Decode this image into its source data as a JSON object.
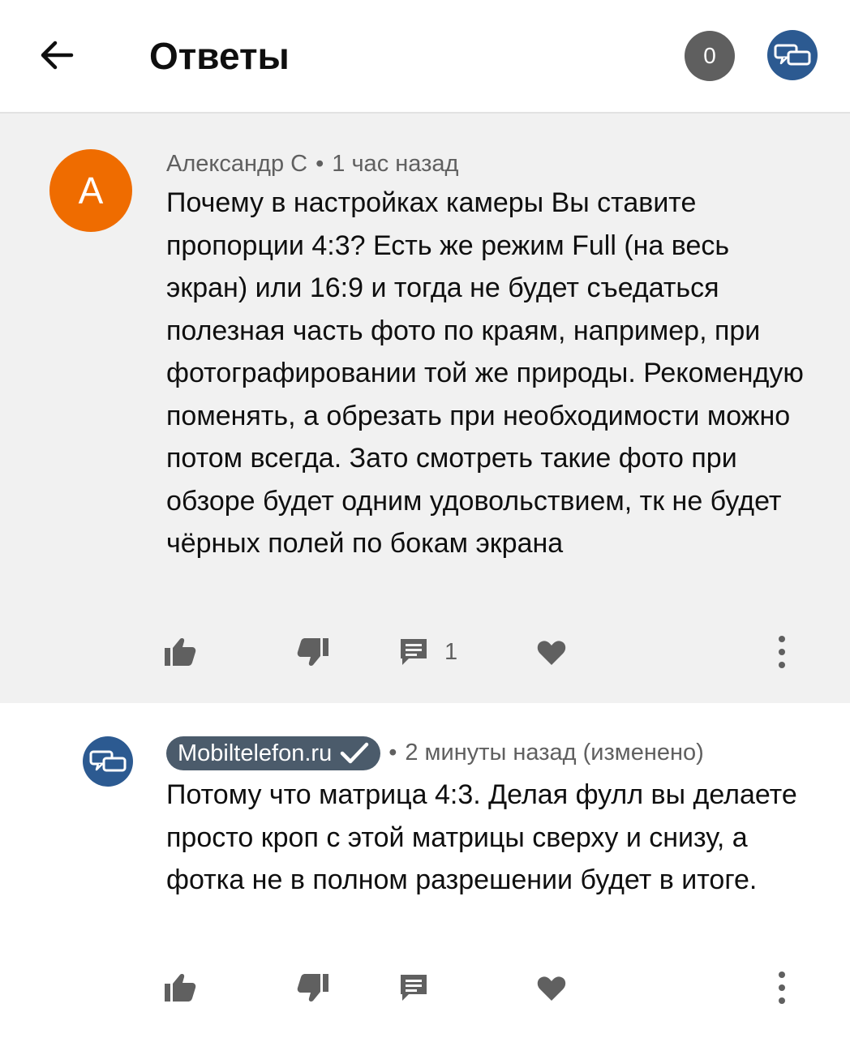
{
  "header": {
    "title": "Ответы",
    "count_badge": "0",
    "back_icon": "arrow-left-icon",
    "avatar_icon": "chat-bubbles-icon"
  },
  "comment": {
    "avatar_letter": "A",
    "avatar_color": "#ef6c00",
    "author": "Александр С",
    "separator": "•",
    "time": "1 час назад",
    "text": "Почему в настройках камеры Вы ставите пропорции 4:3? Есть же режим Full (на весь экран) или 16:9 и тогда не будет съедаться полезная часть фото по краям, например, при фотографировании той же природы. Рекомендую поменять, а обрезать при необходимости можно потом всегда. Зато смотреть такие фото при обзоре будет одним удовольствием, тк не будет чёрных полей по бокам экрана",
    "reply_count": "1"
  },
  "reply": {
    "author": "Mobiltelefon.ru",
    "separator": "•",
    "time": "2 минуты назад (изменено)",
    "text": "Потому что матрица 4:3. Делая фулл вы делаете просто кроп с этой матрицы сверху и снизу, а фотка не в полном разрешении будет в итоге."
  },
  "colors": {
    "comment_bg": "#f1f1f1",
    "channel_blue": "#2c5a91",
    "chip_bg": "#4b5b6b",
    "badge_grey": "#5f5f5f",
    "meta_text": "#606060"
  }
}
